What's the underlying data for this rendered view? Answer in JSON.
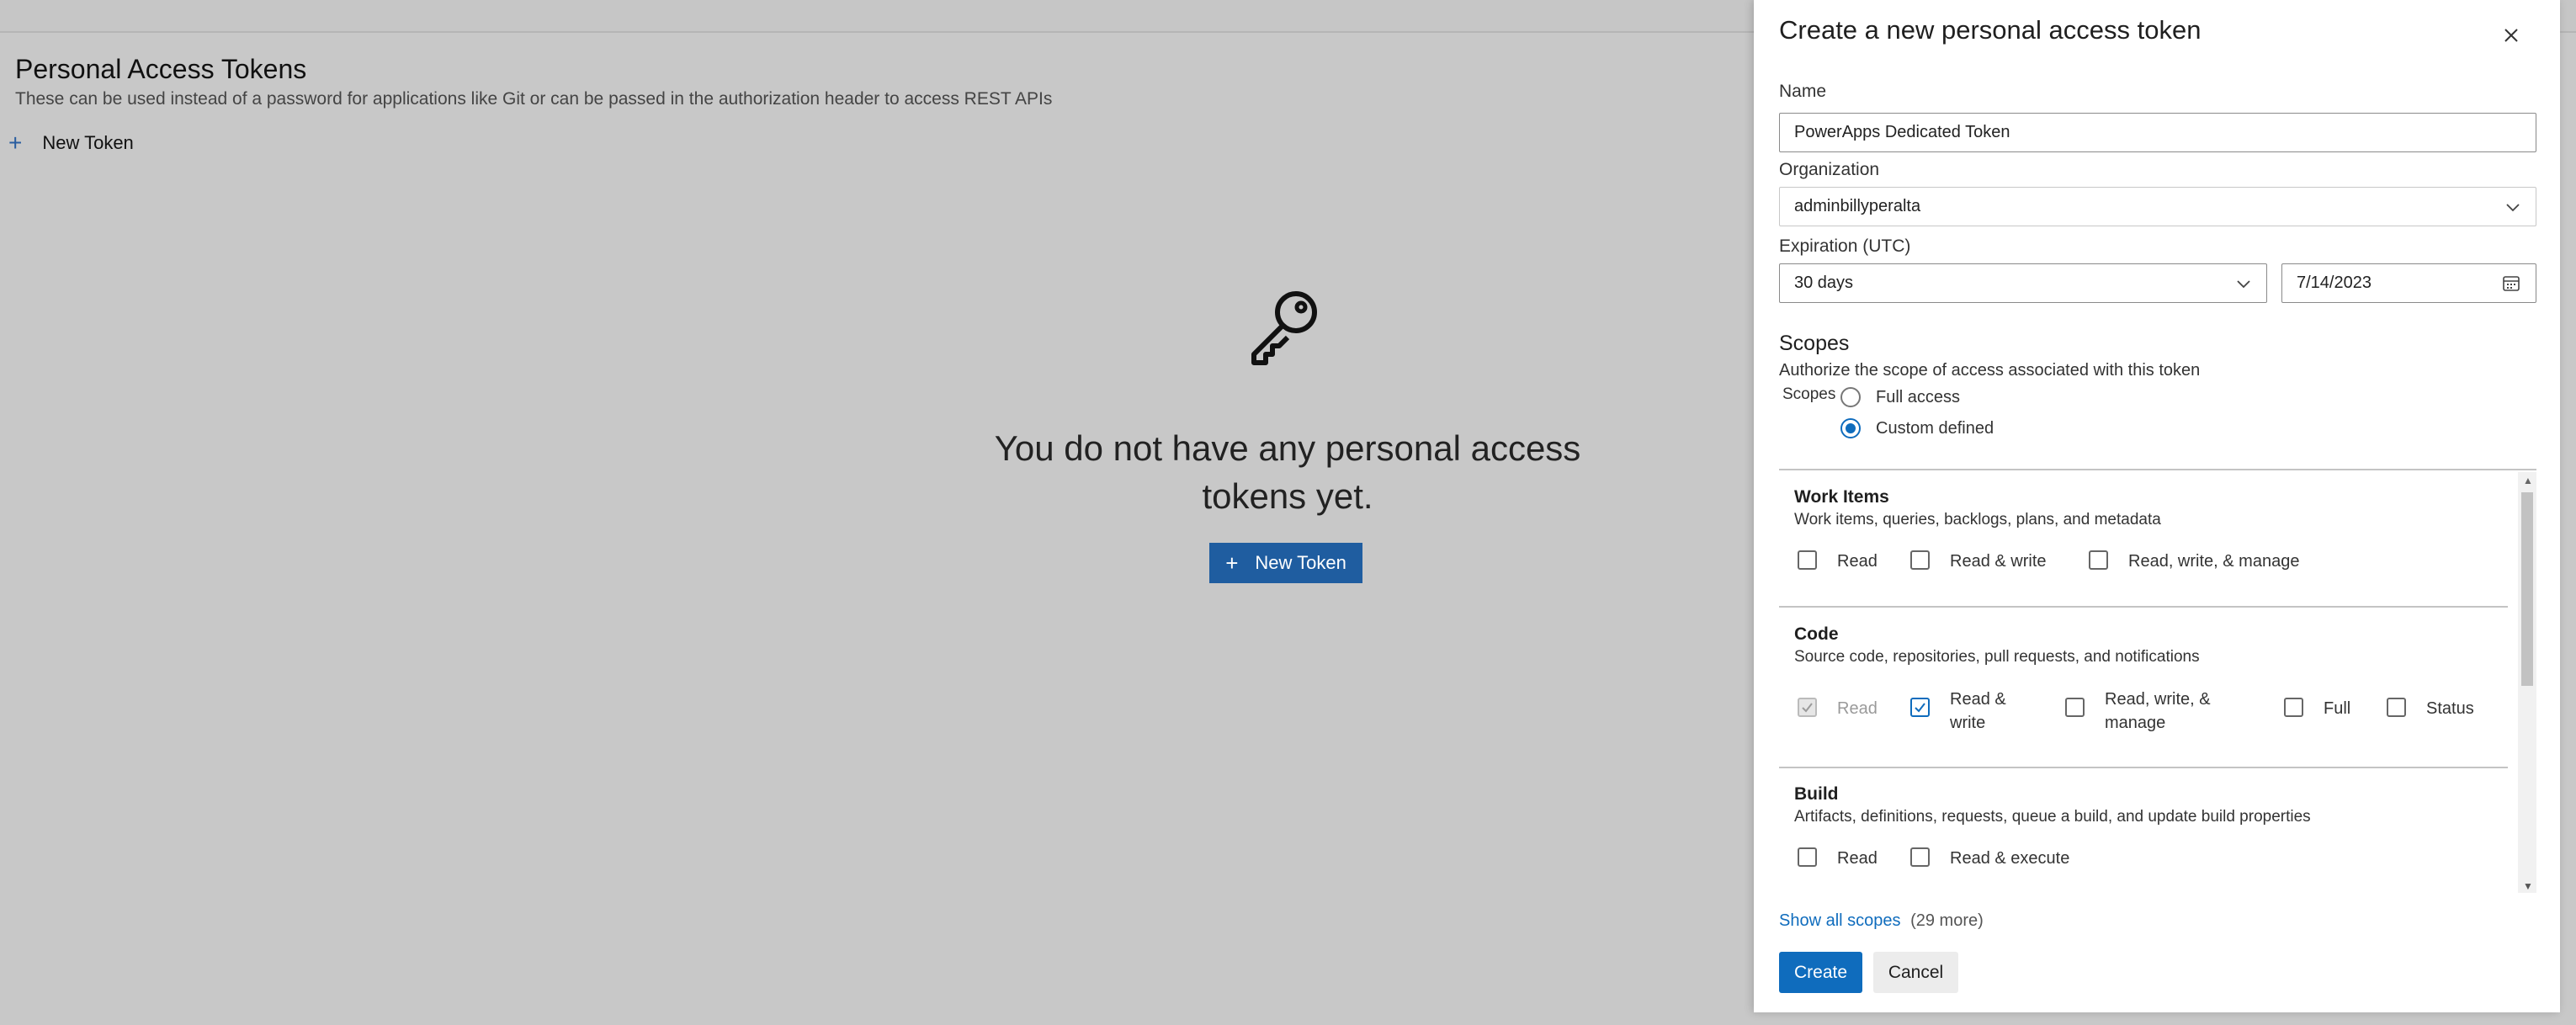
{
  "background": {
    "page_title": "Personal Access Tokens",
    "page_subtitle": "These can be used instead of a password for applications like Git or can be passed in the authorization header to access REST APIs",
    "new_token_link": "New Token",
    "empty_message": "You do not have any personal access tokens yet.",
    "empty_button": "New Token",
    "icons": {
      "plus": "plus-icon",
      "key": "key-icon"
    }
  },
  "panel": {
    "title": "Create a new personal access token",
    "name_label": "Name",
    "name_value": "PowerApps Dedicated Token",
    "org_label": "Organization",
    "org_value": "adminbillyperalta",
    "expiration_label": "Expiration (UTC)",
    "expiration_value": "30 days",
    "expiration_date": "7/14/2023",
    "scopes_heading": "Scopes",
    "scopes_desc": "Authorize the scope of access associated with this token",
    "scopes_inline_label": "Scopes",
    "radio_full": "Full access",
    "radio_custom": "Custom defined",
    "radio_selected": "Custom defined",
    "groups": {
      "work_items": {
        "title": "Work Items",
        "desc": "Work items, queries, backlogs, plans, and metadata",
        "options": [
          "Read",
          "Read & write",
          "Read, write, & manage"
        ]
      },
      "code": {
        "title": "Code",
        "desc": "Source code, repositories, pull requests, and notifications",
        "opt_read": "Read",
        "opt_rw_1": "Read &",
        "opt_rw_2": "write",
        "opt_rwm_1": "Read, write, &",
        "opt_rwm_2": "manage",
        "opt_full": "Full",
        "opt_status": "Status"
      },
      "build": {
        "title": "Build",
        "desc": "Artifacts, definitions, requests, queue a build, and update build properties",
        "options": [
          "Read",
          "Read & execute"
        ]
      }
    },
    "show_all_link": "Show all scopes",
    "show_all_more": "(29 more)",
    "create_label": "Create",
    "cancel_label": "Cancel",
    "accent": "#0f6cbd"
  }
}
